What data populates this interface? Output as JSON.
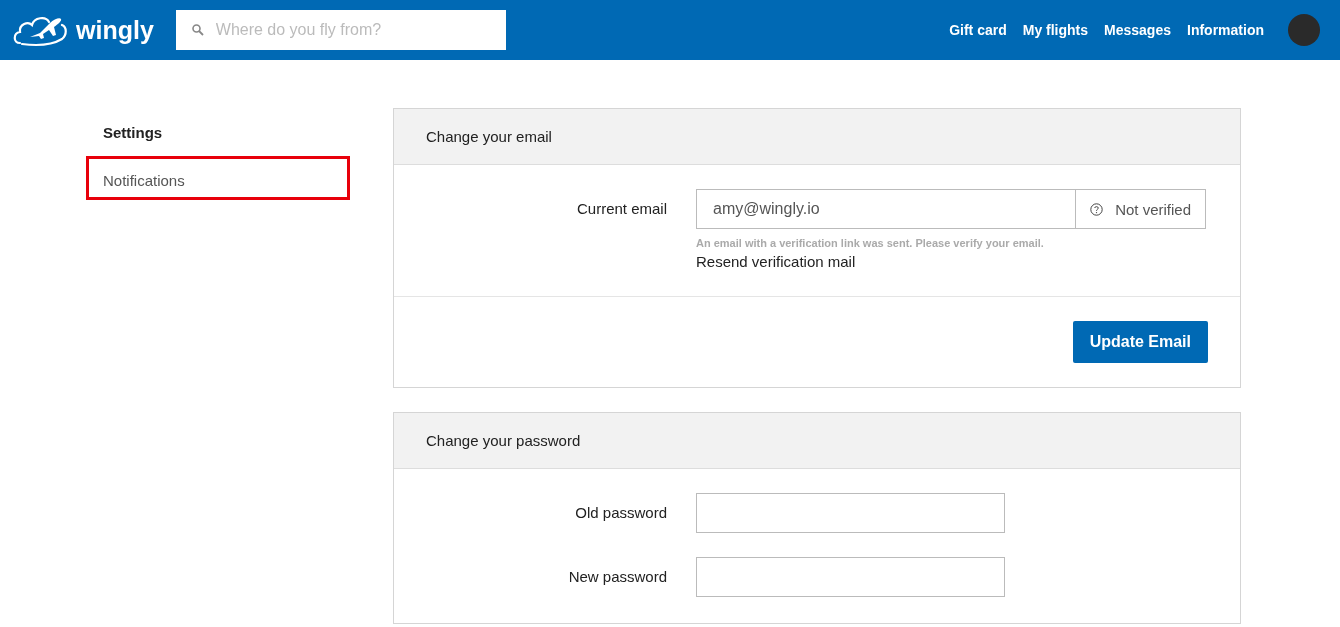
{
  "header": {
    "logo": "wingly",
    "search": {
      "placeholder": "Where do you fly from?"
    },
    "nav": [
      "Gift card",
      "My flights",
      "Messages",
      "Information"
    ]
  },
  "sidebar": {
    "items": [
      {
        "label": "Settings",
        "selected": true,
        "highlighted": false
      },
      {
        "label": "Notifications",
        "selected": false,
        "highlighted": true
      }
    ]
  },
  "email_card": {
    "title": "Change your email",
    "label": "Current email",
    "value": "amy@wingly.io",
    "status": "Not verified",
    "hint": "An email with a verification link was sent. Please verify your email.",
    "resend_link": "Resend verification mail",
    "button": "Update Email"
  },
  "password_card": {
    "title": "Change your password",
    "fields": [
      {
        "label": "Old password"
      },
      {
        "label": "New password"
      }
    ]
  }
}
